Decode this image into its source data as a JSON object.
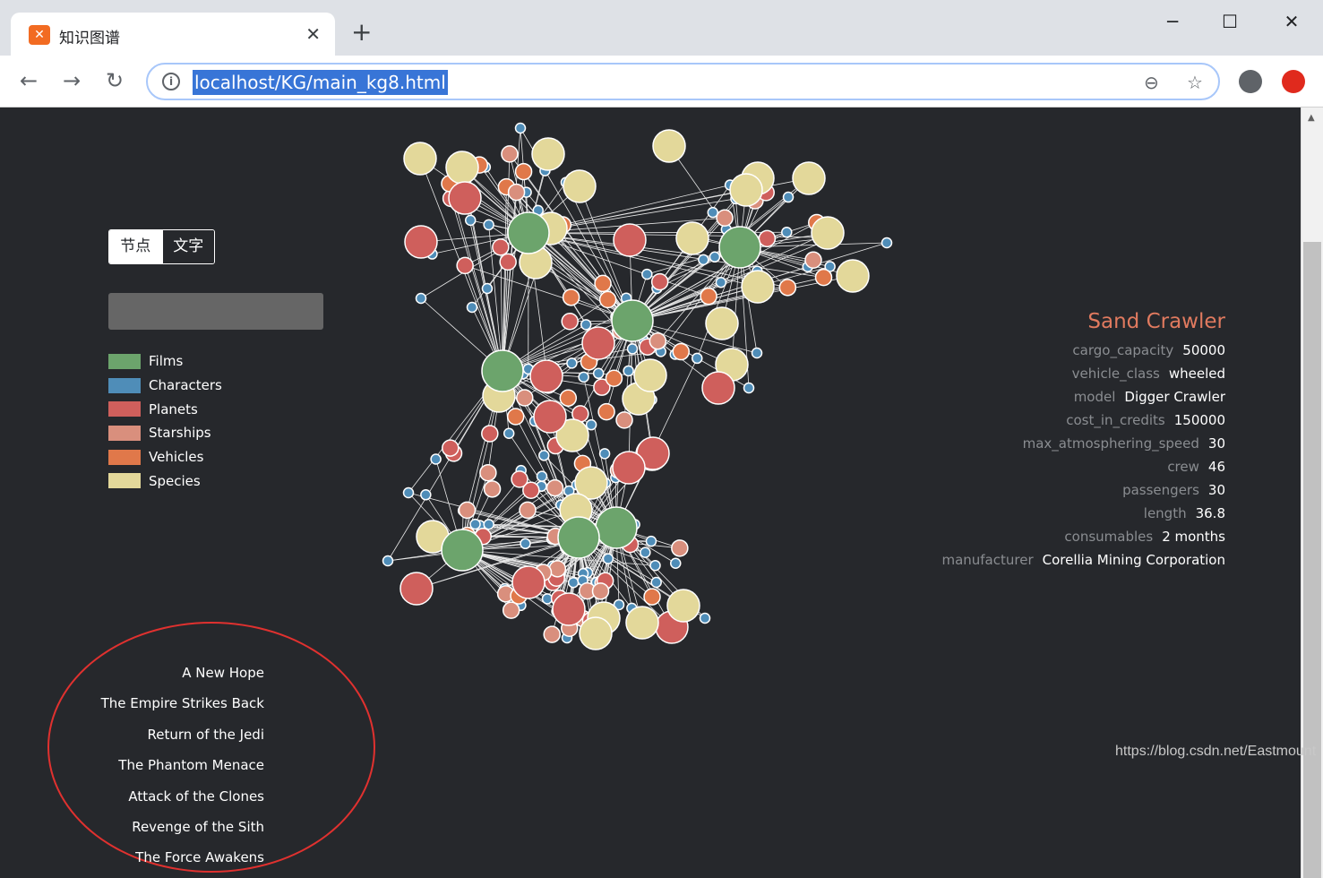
{
  "browser": {
    "tab_title": "知识图谱",
    "favicon_glyph": "☐",
    "new_tab_glyph": "+",
    "close_glyph": "✕",
    "url": "localhost/KG/main_kg8.html",
    "win_minimize": "─",
    "win_maximize": "☐",
    "win_close": "✕",
    "nav_back": "←",
    "nav_forward": "→",
    "nav_reload": "↻",
    "info_glyph": "i",
    "zoom_glyph": "⊖",
    "star_glyph": "☆"
  },
  "controls": {
    "toggle_nodes": "节点",
    "toggle_text": "文字",
    "search_value": ""
  },
  "legend": [
    {
      "label": "Films",
      "color": "#6ca46c"
    },
    {
      "label": "Characters",
      "color": "#4f8db8"
    },
    {
      "label": "Planets",
      "color": "#cf5f5c"
    },
    {
      "label": "Starships",
      "color": "#d98f7d"
    },
    {
      "label": "Vehicles",
      "color": "#e0784a"
    },
    {
      "label": "Species",
      "color": "#e3d89a"
    }
  ],
  "info_panel": {
    "title": "Sand Crawler",
    "rows": [
      {
        "key": "cargo_capacity",
        "value": "50000"
      },
      {
        "key": "vehicle_class",
        "value": "wheeled"
      },
      {
        "key": "model",
        "value": "Digger Crawler"
      },
      {
        "key": "cost_in_credits",
        "value": "150000"
      },
      {
        "key": "max_atmosphering_speed",
        "value": "30"
      },
      {
        "key": "crew",
        "value": "46"
      },
      {
        "key": "passengers",
        "value": "30"
      },
      {
        "key": "length",
        "value": "36.8"
      },
      {
        "key": "consumables",
        "value": "2 months"
      },
      {
        "key": "manufacturer",
        "value": "Corellia Mining Corporation"
      }
    ]
  },
  "films": [
    "A New Hope",
    "The Empire Strikes Back",
    "Return of the Jedi",
    "The Phantom Menace",
    "Attack of the Clones",
    "Revenge of the Sith",
    "The Force Awakens"
  ],
  "watermark": "https://blog.csdn.net/Eastmount",
  "colors": {
    "page_bg": "#26282c",
    "accent_title": "#e07a5f",
    "annotation": "#e0312f",
    "url_highlight": "#3875d7"
  }
}
